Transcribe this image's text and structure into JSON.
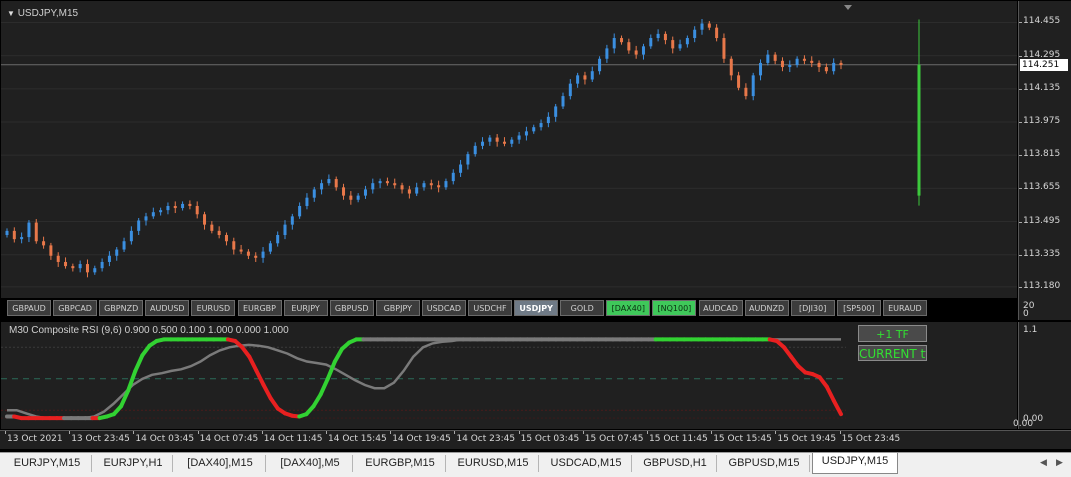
{
  "main_chart": {
    "title": "USDJPY,M15",
    "price_ticks": [
      "114.455",
      "114.295",
      "114.135",
      "113.975",
      "113.815",
      "113.655",
      "113.495",
      "113.335",
      "113.180"
    ],
    "current_price": "114.251",
    "price_range": [
      113.16,
      114.52
    ],
    "current_price_value": 114.251,
    "candles": [
      113.45,
      113.41,
      113.42,
      113.49,
      113.4,
      113.38,
      113.33,
      113.3,
      113.28,
      113.27,
      113.29,
      113.25,
      113.27,
      113.3,
      113.33,
      113.36,
      113.4,
      113.45,
      113.5,
      113.52,
      113.54,
      113.55,
      113.57,
      113.56,
      113.58,
      113.57,
      113.53,
      113.48,
      113.45,
      113.43,
      113.4,
      113.36,
      113.35,
      113.33,
      113.32,
      113.35,
      113.39,
      113.43,
      113.48,
      113.52,
      113.57,
      113.61,
      113.65,
      113.68,
      113.7,
      113.66,
      113.62,
      113.6,
      113.62,
      113.65,
      113.68,
      113.69,
      113.68,
      113.67,
      113.65,
      113.63,
      113.66,
      113.68,
      113.67,
      113.66,
      113.69,
      113.73,
      113.77,
      113.82,
      113.86,
      113.88,
      113.9,
      113.88,
      113.87,
      113.89,
      113.91,
      113.93,
      113.95,
      113.97,
      114.0,
      114.05,
      114.1,
      114.16,
      114.2,
      114.18,
      114.22,
      114.28,
      114.33,
      114.38,
      114.36,
      114.32,
      114.3,
      114.34,
      114.38,
      114.4,
      114.37,
      114.33,
      114.35,
      114.38,
      114.42,
      114.45,
      114.43,
      114.38,
      114.28,
      114.2,
      114.14,
      114.1,
      114.2,
      114.26,
      114.3,
      114.27,
      114.24,
      114.25,
      114.28,
      114.27,
      114.26,
      114.24,
      114.22,
      114.26,
      114.25
    ],
    "green_bar": {
      "from": 113.62,
      "to": 114.46
    },
    "symbol_buttons": [
      {
        "label": "GBPAUD",
        "style": "normal"
      },
      {
        "label": "GBPCAD",
        "style": "normal"
      },
      {
        "label": "GBPNZD",
        "style": "normal"
      },
      {
        "label": "AUDUSD",
        "style": "normal"
      },
      {
        "label": "EURUSD",
        "style": "normal"
      },
      {
        "label": "EURGBP",
        "style": "normal"
      },
      {
        "label": "EURJPY",
        "style": "normal"
      },
      {
        "label": "GBPUSD",
        "style": "normal"
      },
      {
        "label": "GBPJPY",
        "style": "normal"
      },
      {
        "label": "USDCAD",
        "style": "normal"
      },
      {
        "label": "USDCHF",
        "style": "normal"
      },
      {
        "label": "USDJPY",
        "style": "active"
      },
      {
        "label": "GOLD",
        "style": "normal"
      },
      {
        "label": "[DAX40]",
        "style": "green"
      },
      {
        "label": "[NQ100]",
        "style": "green"
      },
      {
        "label": "AUDCAD",
        "style": "normal"
      },
      {
        "label": "AUDNZD",
        "style": "normal"
      },
      {
        "label": "[DJI30]",
        "style": "normal"
      },
      {
        "label": "[SP500]",
        "style": "normal"
      },
      {
        "label": "EURAUD",
        "style": "normal"
      }
    ]
  },
  "separator": {
    "top_value": "20",
    "bottom_value": "0"
  },
  "indicator": {
    "title": "M30 Composite RSI (9,6) 0.900 0.500 0.100 1.000 0.000 1.000",
    "ticks": [
      "1.1",
      "0.00"
    ],
    "tick_extra": "0.00",
    "range": [
      -0.05,
      1.12
    ],
    "tf_button": "+1 TF",
    "tf_label": "CURRENT tf",
    "colors": {
      "up": "#32d232",
      "down": "#e82020",
      "neutral": "#7a7a7a"
    },
    "composite": [
      0.02,
      0.02,
      0.0,
      0.0,
      0.0,
      0.0,
      0.0,
      0.0,
      0.0,
      0.0,
      0.0,
      0.0,
      0.0,
      0.0,
      0.02,
      0.05,
      0.15,
      0.35,
      0.6,
      0.8,
      0.92,
      0.98,
      1.0,
      1.0,
      1.0,
      1.0,
      1.0,
      1.0,
      1.0,
      1.0,
      1.0,
      1.0,
      0.98,
      0.9,
      0.78,
      0.6,
      0.42,
      0.25,
      0.12,
      0.06,
      0.03,
      0.02,
      0.05,
      0.15,
      0.3,
      0.5,
      0.72,
      0.88,
      0.96,
      1.0,
      1.0,
      1.0,
      1.0,
      1.0,
      1.0,
      1.0,
      1.0,
      1.0,
      1.0,
      1.0,
      1.0,
      1.0,
      1.0,
      1.0,
      1.0,
      1.0,
      1.0,
      1.0,
      1.0,
      1.0,
      1.0,
      1.0,
      1.0,
      1.0,
      1.0,
      1.0,
      1.0,
      1.0,
      1.0,
      1.0,
      1.0,
      1.0,
      1.0,
      1.0,
      1.0,
      1.0,
      1.0,
      1.0,
      1.0,
      1.0,
      1.0,
      1.0,
      1.0,
      1.0,
      1.0,
      1.0,
      1.0,
      1.0,
      1.0,
      1.0,
      1.0,
      1.0,
      1.0,
      1.0,
      1.0,
      1.0,
      1.0,
      1.0,
      0.98,
      0.9,
      0.78,
      0.66,
      0.58,
      0.56,
      0.52,
      0.4,
      0.22,
      0.05
    ],
    "slow": [
      0.1,
      0.1,
      0.06,
      0.02,
      0.0,
      0.0,
      0.0,
      0.0,
      0.0,
      0.02,
      0.08,
      0.18,
      0.3,
      0.42,
      0.5,
      0.55,
      0.57,
      0.6,
      0.62,
      0.66,
      0.72,
      0.8,
      0.86,
      0.9,
      0.92,
      0.93,
      0.92,
      0.9,
      0.86,
      0.82,
      0.76,
      0.72,
      0.7,
      0.68,
      0.62,
      0.55,
      0.48,
      0.42,
      0.38,
      0.38,
      0.45,
      0.6,
      0.78,
      0.9,
      0.95,
      0.97,
      0.98,
      1.0,
      1.0,
      1.0
    ]
  },
  "time_axis": {
    "labels": [
      "13 Oct 2021",
      "13 Oct 23:45",
      "14 Oct 03:45",
      "14 Oct 07:45",
      "14 Oct 11:45",
      "14 Oct 15:45",
      "14 Oct 19:45",
      "14 Oct 23:45",
      "15 Oct 03:45",
      "15 Oct 07:45",
      "15 Oct 11:45",
      "15 Oct 15:45",
      "15 Oct 19:45",
      "15 Oct 23:45"
    ]
  },
  "tabs": {
    "items": [
      "EURJPY,M15",
      "EURJPY,H1",
      "[DAX40],M15",
      "[DAX40],M5",
      "EURGBP,M15",
      "EURUSD,M15",
      "USDCAD,M15",
      "GBPUSD,H1",
      "GBPUSD,M15",
      "USDJPY,M15"
    ],
    "active_index": 9
  }
}
